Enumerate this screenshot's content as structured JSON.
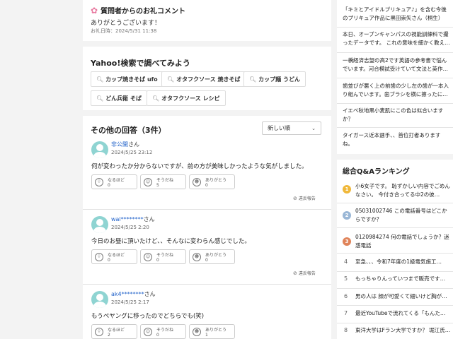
{
  "thanks": {
    "title": "質問者からのお礼コメント",
    "message": "ありがとうございます！",
    "date": "お礼日時：2024/5/31 11:38"
  },
  "search": {
    "title": "Yahoo!検索で調べてみよう",
    "chips": [
      "カップ焼きそば ufo",
      "オタフクソース 焼きそば",
      "カップ麺 うどん",
      "どん兵衛 そば",
      "オタフクソース レシピ"
    ]
  },
  "answers_section": {
    "title": "その他の回答（3件）",
    "sort_label": "新しい順",
    "report_label": "違反報告",
    "reaction_labels": [
      "なるほど",
      "そうだね",
      "ありがとう"
    ],
    "answers": [
      {
        "name": "非公開",
        "suffix": "さん",
        "date": "2024/5/25 23:12",
        "text": "何が変わったか分からないですが、前の方が美味しかったような気がしました。",
        "counts": [
          "0",
          "5",
          "0"
        ]
      },
      {
        "name": "wal********",
        "suffix": "さん",
        "date": "2024/5/25 2:20",
        "text": "今日のお昼に頂いたけど、、そんなに変わらん感じでした。",
        "counts": [
          "0",
          "0",
          "0"
        ]
      },
      {
        "name": "ak4********",
        "suffix": "さん",
        "date": "2024/5/25 2:17",
        "text": "もうペヤングに移ったのでどちらでも(笑)",
        "counts": [
          "2",
          "0",
          "1"
        ]
      }
    ]
  },
  "sidebar": {
    "items": [
      "「キミとアイドルプリキュア♪」を含む今後のプリキュア作品に黒田崇矢さん（桐生）と…",
      "本日、オープンキャンパスの視能訓練科で撮ったデータです。 これの意味を細かく教え…",
      "一橋経済志望の高2です英語の参考書で悩んでいます。河合模試受けていて文法と英作…",
      "歯並びが悪く上の前歯の少し左の歯が一本入り組んでいます。歯ブラシを横に擦ったに…",
      "イエベ秋地黒小麦肌にこの色は似合いますか？",
      "タイガース近本選手、、首位打者ありますね。"
    ],
    "ranking_title": "総合Q&Aランキング",
    "ranking": [
      {
        "rank": "1",
        "text": "小6女子です。 恥ずかしい内容でごめんなさい。 今付き合ってる中2の彼…"
      },
      {
        "rank": "2",
        "text": "05031002746 この電話番号はどこからですか？"
      },
      {
        "rank": "3",
        "text": "0120984274 何の電話でしょうか？迷惑電話"
      },
      {
        "rank": "4",
        "text": "至急、、、令和7年度の1級電気施工…"
      },
      {
        "rank": "5",
        "text": "もっちゃりんっていつまで販売です…"
      },
      {
        "rank": "6",
        "text": "男の人は 顔が可愛くて細いけど胸が…"
      },
      {
        "rank": "7",
        "text": "最近YouTubeで流れてくる「もんた…"
      },
      {
        "rank": "8",
        "text": "東洋大学はFラン大学ですか？ 堀江氏…"
      }
    ],
    "badge_colors": [
      "#f0b83a",
      "#9ab7d6",
      "#e0845a"
    ]
  }
}
